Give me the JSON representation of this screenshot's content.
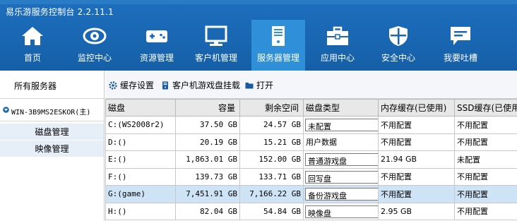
{
  "app": {
    "title": "易乐游服务控制台 2.2.11.1"
  },
  "nav": [
    {
      "label": "首页",
      "icon": "home-icon"
    },
    {
      "label": "监控中心",
      "icon": "eye-icon"
    },
    {
      "label": "资源管理",
      "icon": "gamepad-icon"
    },
    {
      "label": "客户机管理",
      "icon": "monitor-icon"
    },
    {
      "label": "服务器管理",
      "icon": "server-icon"
    },
    {
      "label": "应用中心",
      "icon": "toolbox-icon"
    },
    {
      "label": "安全中心",
      "icon": "shield-icon"
    },
    {
      "label": "我要吐槽",
      "icon": "chat-icon"
    }
  ],
  "nav_active_index": 4,
  "sidebar": {
    "all_servers": "所有服务器",
    "server_name": "WIN-3B9MS2ESKOR(主)",
    "sub_items": [
      "磁盘管理",
      "映像管理"
    ]
  },
  "toolbar": {
    "cache_settings": "缓存设置",
    "client_disk_mount": "客户机游戏盘挂载",
    "open": "打开"
  },
  "table": {
    "headers": [
      "磁盘",
      "容量",
      "剩余空间",
      "磁盘类型",
      "内存缓存(已使用)",
      "SSD缓存(已使用"
    ],
    "rows": [
      {
        "disk": "C:(WS2008r2)",
        "capacity": "37.50 GB",
        "free": "24.57 GB",
        "type": "未配置",
        "type_combo": true,
        "mem_cache": "不用配置",
        "ssd_cache": "不用配置"
      },
      {
        "disk": "D:()",
        "capacity": "20.19 GB",
        "free": "15.21 GB",
        "type": "用户数据",
        "type_combo": false,
        "mem_cache": "不用配置",
        "ssd_cache": "不用配置"
      },
      {
        "disk": "E:()",
        "capacity": "1,863.01 GB",
        "free": "152.00 GB",
        "type": "普通游戏盘",
        "type_combo": true,
        "mem_cache": "21.94 GB",
        "ssd_cache": "未配置"
      },
      {
        "disk": "F:()",
        "capacity": "139.73 GB",
        "free": "133.71 GB",
        "type": "回写盘",
        "type_combo": true,
        "mem_cache": "不用配置",
        "ssd_cache": "不用配置"
      },
      {
        "disk": "G:(game)",
        "capacity": "7,451.91 GB",
        "free": "7,166.22 GB",
        "type": "备份游戏盘",
        "type_combo": true,
        "mem_cache": "不用配置",
        "ssd_cache": "不用配置"
      },
      {
        "disk": "H:()",
        "capacity": "82.04 GB",
        "free": "54.84 GB",
        "type": "映像盘",
        "type_combo": true,
        "mem_cache": "2.95 GB",
        "ssd_cache": "不用配置"
      }
    ],
    "selected_row": 4
  },
  "colors": {
    "nav_bg": "#1a68b5",
    "nav_active": "#2f8fd9",
    "sub_item_bg": "#e6eef8",
    "selected_row": "#cfe3f7"
  }
}
